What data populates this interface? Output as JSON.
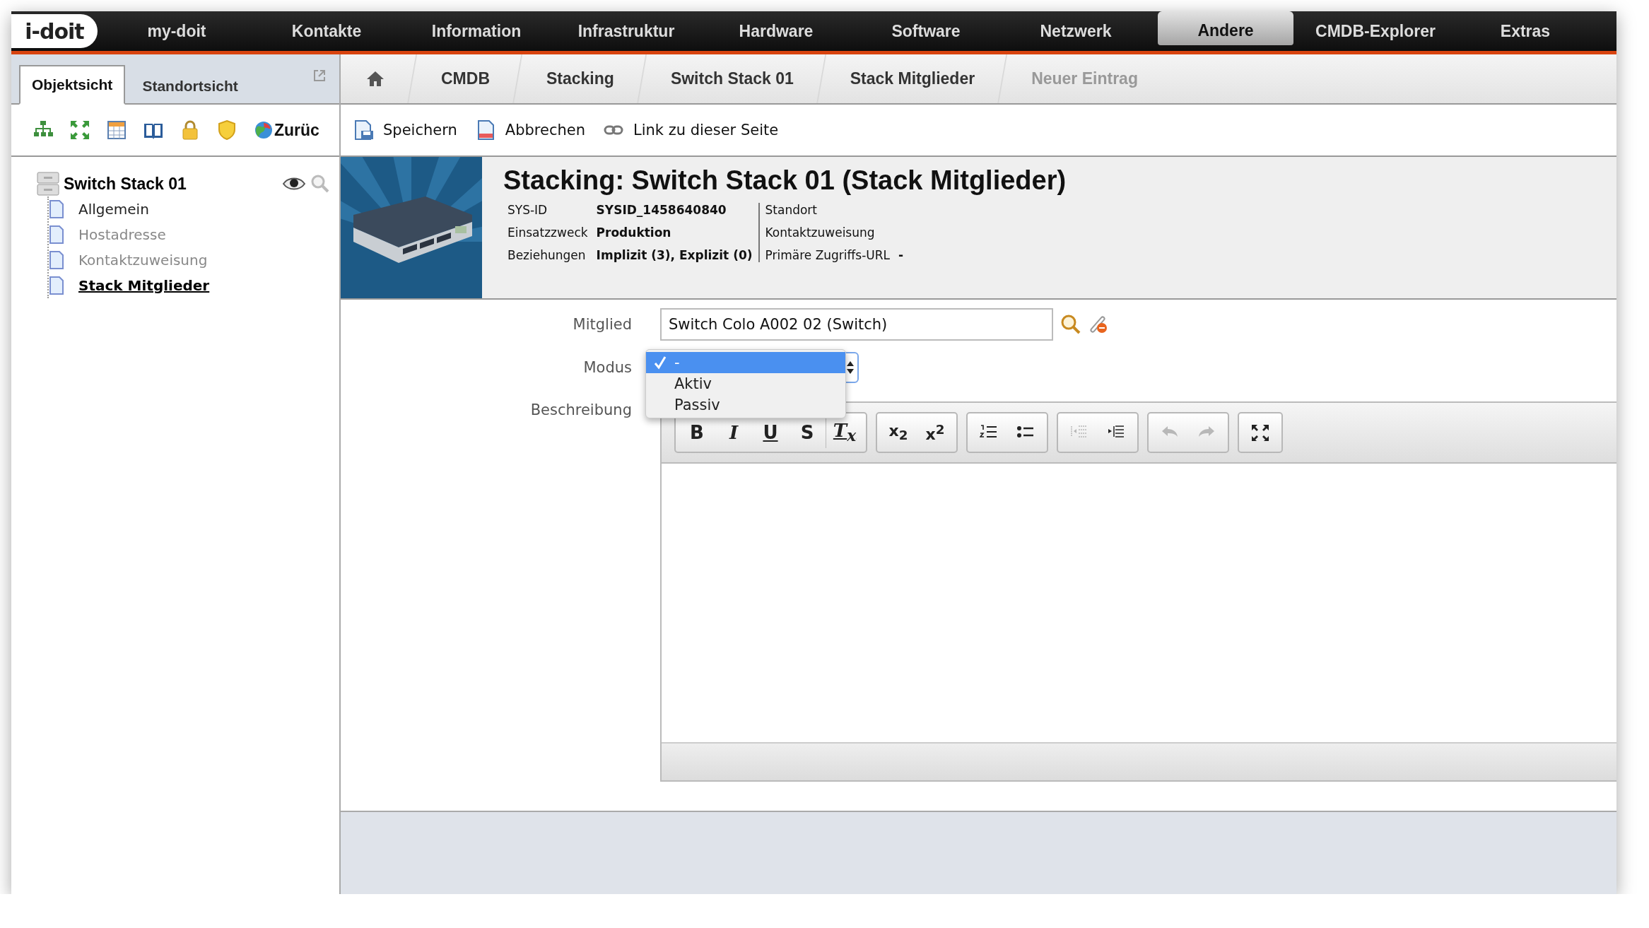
{
  "nav": {
    "logo": "i-doit",
    "items": [
      {
        "label": "my-doit",
        "selected": false
      },
      {
        "label": "Kontakte",
        "selected": false
      },
      {
        "label": "Information",
        "selected": false
      },
      {
        "label": "Infrastruktur",
        "selected": false
      },
      {
        "label": "Hardware",
        "selected": false
      },
      {
        "label": "Software",
        "selected": false
      },
      {
        "label": "Netzwerk",
        "selected": false
      },
      {
        "label": "Andere",
        "selected": true
      },
      {
        "label": "CMDB-Explorer",
        "selected": false
      },
      {
        "label": "Extras",
        "selected": false
      }
    ]
  },
  "sidebar": {
    "tabs": [
      {
        "label": "Objektsicht",
        "selected": true
      },
      {
        "label": "Standortsicht",
        "selected": false
      }
    ],
    "toolbar": [
      {
        "kind": "tree"
      },
      {
        "kind": "expand"
      },
      {
        "kind": "calendar"
      },
      {
        "kind": "book"
      },
      {
        "kind": "lock"
      },
      {
        "kind": "shield"
      },
      {
        "kind": "back",
        "label": "Zurüc"
      }
    ],
    "tree": {
      "label": "Switch Stack 01",
      "children": [
        {
          "label": "Allgemein",
          "filled": true,
          "selected": false
        },
        {
          "label": "Hostadresse",
          "filled": false,
          "selected": false
        },
        {
          "label": "Kontaktzuweisung",
          "filled": false,
          "selected": false
        },
        {
          "label": "Stack Mitglieder",
          "filled": true,
          "selected": true
        }
      ]
    }
  },
  "breadcrumb": [
    {
      "kind": "home",
      "disabled": false
    },
    {
      "kind": "text",
      "label": "CMDB",
      "disabled": false
    },
    {
      "kind": "text",
      "label": "Stacking",
      "disabled": false
    },
    {
      "kind": "text",
      "label": "Switch Stack 01",
      "disabled": false
    },
    {
      "kind": "text",
      "label": "Stack Mitglieder",
      "disabled": false
    },
    {
      "kind": "text",
      "label": "Neuer Eintrag",
      "disabled": true
    }
  ],
  "actions": [
    {
      "kind": "save",
      "label": "Speichern"
    },
    {
      "kind": "cancel",
      "label": "Abbrechen"
    },
    {
      "kind": "link",
      "label": "Link zu dieser Seite"
    }
  ],
  "header": {
    "title": "Stacking: Switch Stack 01 (Stack Mitglieder)",
    "left": [
      {
        "label": "SYS-ID",
        "value": "SYSID_1458640840"
      },
      {
        "label": "Einsatzzweck",
        "value": "Produktion"
      },
      {
        "label": "Beziehungen",
        "value": "Implizit (3), Explizit (0)"
      }
    ],
    "right": [
      {
        "label": "Standort"
      },
      {
        "label": "Kontaktzuweisung"
      },
      {
        "label": "Primäre Zugriffs-URL",
        "value": "-"
      }
    ]
  },
  "form": {
    "member": {
      "label": "Mitglied",
      "value": "Switch Colo A002 02 (Switch)"
    },
    "mode": {
      "label": "Modus",
      "expanded": true,
      "options": [
        {
          "label": "-",
          "selected": true
        },
        {
          "label": "Aktiv",
          "selected": false
        },
        {
          "label": "Passiv",
          "selected": false
        }
      ]
    },
    "description": {
      "label": "Beschreibung",
      "toolbar": [
        [
          {
            "kind": "bold",
            "label": "B",
            "disabled": false
          },
          {
            "kind": "italic",
            "label": "I",
            "disabled": false
          },
          {
            "kind": "underline",
            "label": "U",
            "disabled": false
          },
          {
            "kind": "strike",
            "label": "S",
            "disabled": false
          },
          {
            "kind": "clear",
            "label": "T$_{x}$",
            "disabled": false
          }
        ],
        [
          {
            "kind": "script",
            "label": "x$_{2}$",
            "disabled": false
          },
          {
            "kind": "script",
            "label": "x$^{2}$",
            "disabled": false
          }
        ],
        [
          {
            "kind": "numbered-list",
            "disabled": false
          },
          {
            "kind": "bullet-list",
            "disabled": false
          }
        ],
        [
          {
            "kind": "outdent",
            "disabled": true
          },
          {
            "kind": "indent",
            "disabled": false
          }
        ],
        [
          {
            "kind": "undo",
            "disabled": true
          },
          {
            "kind": "redo",
            "disabled": true
          }
        ],
        [
          {
            "kind": "maximize",
            "disabled": false
          }
        ]
      ]
    }
  }
}
